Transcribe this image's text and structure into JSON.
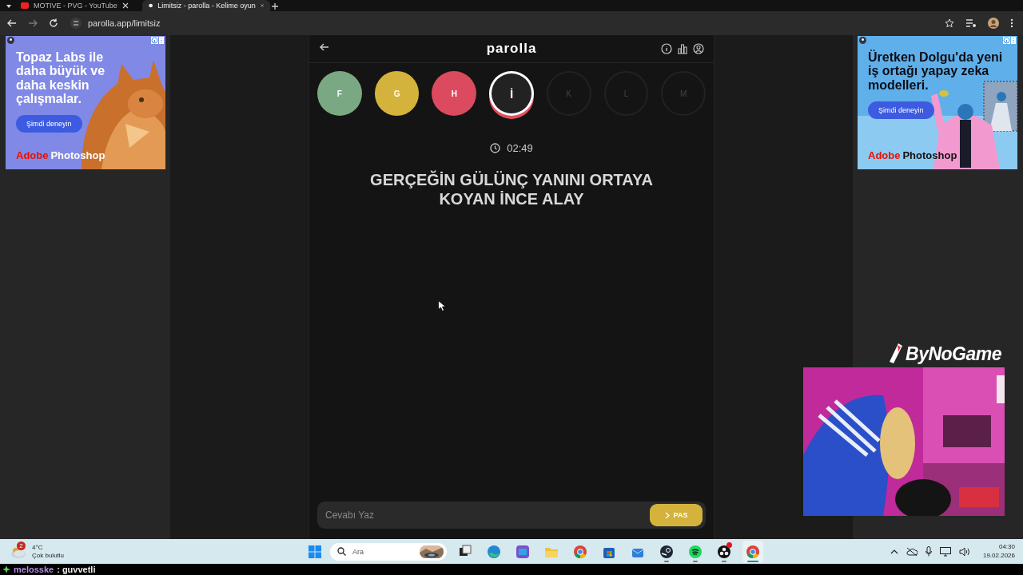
{
  "browser": {
    "tabs": [
      {
        "title": "MOTIVE - PVG - YouTube",
        "selected": false
      },
      {
        "title": "Limitsiz - parolla - Kelime oyun",
        "selected": true
      }
    ],
    "url": "parolla.app/limitsiz"
  },
  "ads": [
    {
      "kind": "cat",
      "headline": "Topaz Labs ile daha büyük ve daha keskin çalışmalar.",
      "button": "Şimdi deneyin",
      "brand": [
        "Adobe",
        "Photoshop"
      ]
    },
    {
      "kind": "person",
      "headline": "Üretken Dolgu'da yeni iş ortağı yapay zeka modelleri.",
      "button": "Şimdi deneyin",
      "brand": [
        "Adobe",
        "Photoshop"
      ]
    }
  ],
  "app": {
    "title": "parolla",
    "letters": [
      {
        "letter": "F",
        "kind": "correct"
      },
      {
        "letter": "G",
        "kind": "passed"
      },
      {
        "letter": "H",
        "kind": "wrong"
      },
      {
        "letter": "İ",
        "kind": "current"
      },
      {
        "letter": "K",
        "kind": "pending"
      },
      {
        "letter": "L",
        "kind": "pending"
      },
      {
        "letter": "M",
        "kind": "pending"
      }
    ],
    "timer": "02:49",
    "question": "GERÇEĞİN GÜLÜNÇ YANINI ORTAYA KOYAN İNCE ALAY",
    "answer": {
      "placeholder": "Cevabı Yaz"
    },
    "pass_button": "PAS"
  },
  "taskbar": {
    "weather": {
      "badge": "2",
      "temperature": "4°C",
      "condition": "Çok bulutlu"
    },
    "search": {
      "placeholder": "Ara"
    },
    "apps": [
      {
        "kind": "task-view",
        "running": false,
        "active": false,
        "notification": false
      },
      {
        "kind": "edge",
        "running": false,
        "active": false,
        "notification": false
      },
      {
        "kind": "office",
        "running": false,
        "active": false,
        "notification": false
      },
      {
        "kind": "folder",
        "running": false,
        "active": false,
        "notification": false
      },
      {
        "kind": "chrome",
        "running": false,
        "active": false,
        "notification": false
      },
      {
        "kind": "store",
        "running": false,
        "active": false,
        "notification": false
      },
      {
        "kind": "mail",
        "running": false,
        "active": false,
        "notification": false
      },
      {
        "kind": "steam",
        "running": true,
        "active": false,
        "notification": false
      },
      {
        "kind": "spotify",
        "running": true,
        "active": false,
        "notification": false
      },
      {
        "kind": "obs",
        "running": true,
        "active": false,
        "notification": true
      },
      {
        "kind": "chrome",
        "running": true,
        "active": true,
        "notification": false
      }
    ],
    "time": "04:30",
    "date": "19.02.2026"
  },
  "stream": {
    "logo": "ByNoGame",
    "chat": {
      "user": "melosske",
      "message": ": guvvetli"
    }
  }
}
